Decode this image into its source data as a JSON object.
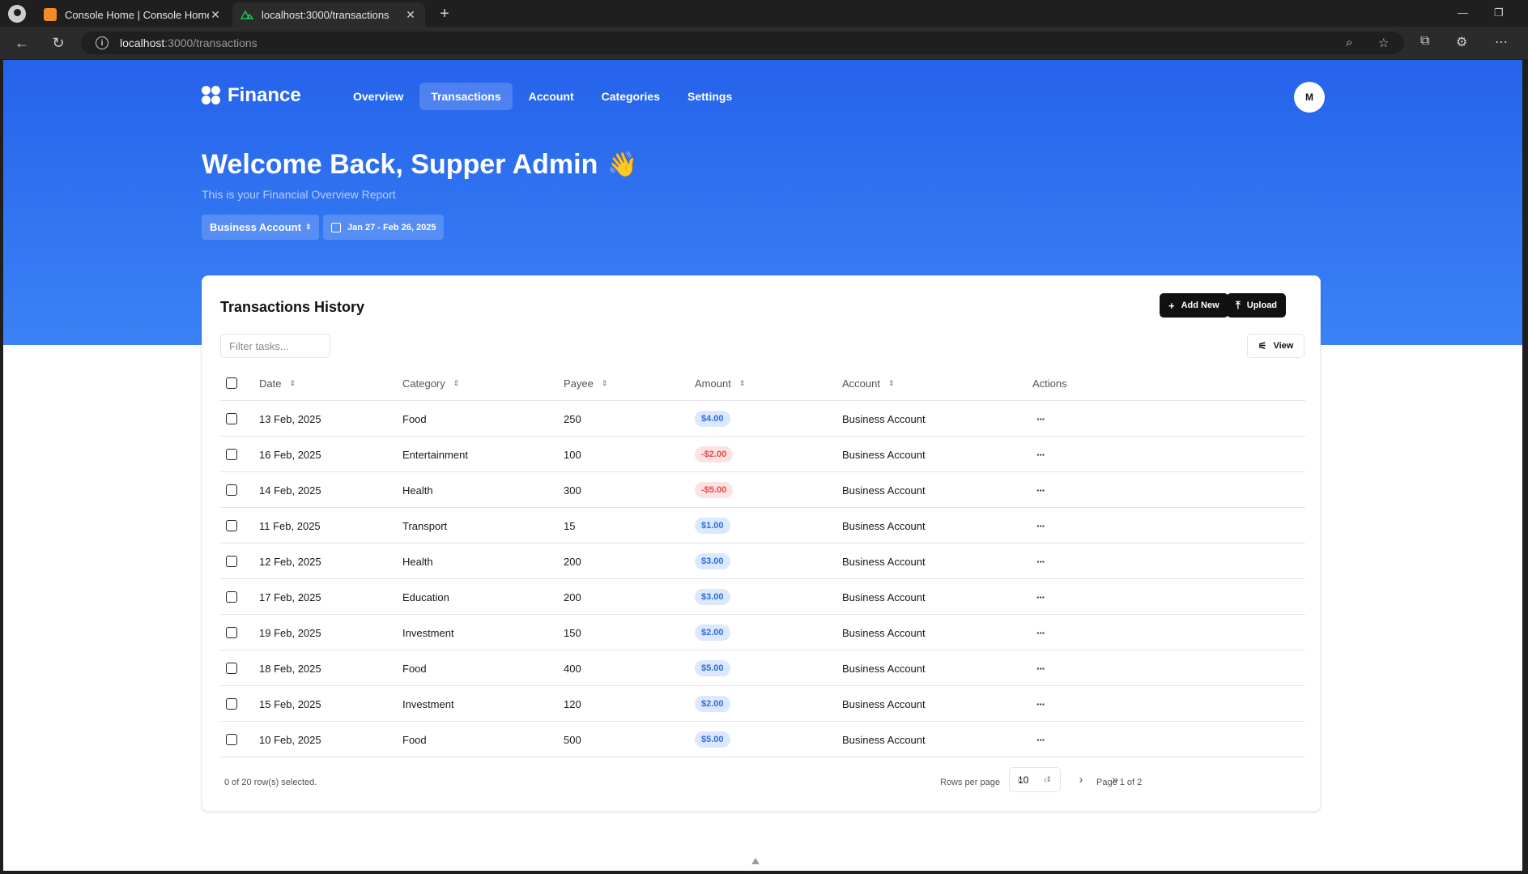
{
  "browser": {
    "tabs": [
      {
        "title": "Console Home | Console Home |",
        "favicon_color": "#f28c28"
      },
      {
        "title": "localhost:3000/transactions",
        "favicon_color": "#22c55e"
      }
    ],
    "url_host": "localhost",
    "url_path": ":3000/transactions"
  },
  "app": {
    "brand": "Finance",
    "nav": [
      "Overview",
      "Transactions",
      "Account",
      "Categories",
      "Settings"
    ],
    "active_nav": "Transactions",
    "avatar_initial": "M",
    "welcome": "Welcome Back, Supper Admin",
    "welcome_emoji": "👋",
    "subtitle": "This is your Financial Overview Report",
    "account_select": "Business Account",
    "date_range": "Jan 27 - Feb 26, 2025"
  },
  "table": {
    "title": "Transactions History",
    "add_new": "Add New",
    "upload": "Upload",
    "filter_placeholder": "Filter tasks...",
    "view": "View",
    "headers": {
      "date": "Date",
      "category": "Category",
      "payee": "Payee",
      "amount": "Amount",
      "account": "Account",
      "actions": "Actions"
    },
    "rows": [
      {
        "date": "13 Feb, 2025",
        "category": "Food",
        "payee": "250",
        "amount": "$4.00",
        "negative": false,
        "account": "Business Account"
      },
      {
        "date": "16 Feb, 2025",
        "category": "Entertainment",
        "payee": "100",
        "amount": "-$2.00",
        "negative": true,
        "account": "Business Account"
      },
      {
        "date": "14 Feb, 2025",
        "category": "Health",
        "payee": "300",
        "amount": "-$5.00",
        "negative": true,
        "account": "Business Account"
      },
      {
        "date": "11 Feb, 2025",
        "category": "Transport",
        "payee": "15",
        "amount": "$1.00",
        "negative": false,
        "account": "Business Account"
      },
      {
        "date": "12 Feb, 2025",
        "category": "Health",
        "payee": "200",
        "amount": "$3.00",
        "negative": false,
        "account": "Business Account"
      },
      {
        "date": "17 Feb, 2025",
        "category": "Education",
        "payee": "200",
        "amount": "$3.00",
        "negative": false,
        "account": "Business Account"
      },
      {
        "date": "19 Feb, 2025",
        "category": "Investment",
        "payee": "150",
        "amount": "$2.00",
        "negative": false,
        "account": "Business Account"
      },
      {
        "date": "18 Feb, 2025",
        "category": "Food",
        "payee": "400",
        "amount": "$5.00",
        "negative": false,
        "account": "Business Account"
      },
      {
        "date": "15 Feb, 2025",
        "category": "Investment",
        "payee": "120",
        "amount": "$2.00",
        "negative": false,
        "account": "Business Account"
      },
      {
        "date": "10 Feb, 2025",
        "category": "Food",
        "payee": "500",
        "amount": "$5.00",
        "negative": false,
        "account": "Business Account"
      }
    ],
    "selection_status": "0 of 20 row(s) selected.",
    "rows_per_page_label": "Rows per page",
    "rows_per_page": "10",
    "page_info": "Page 1 of 2"
  }
}
